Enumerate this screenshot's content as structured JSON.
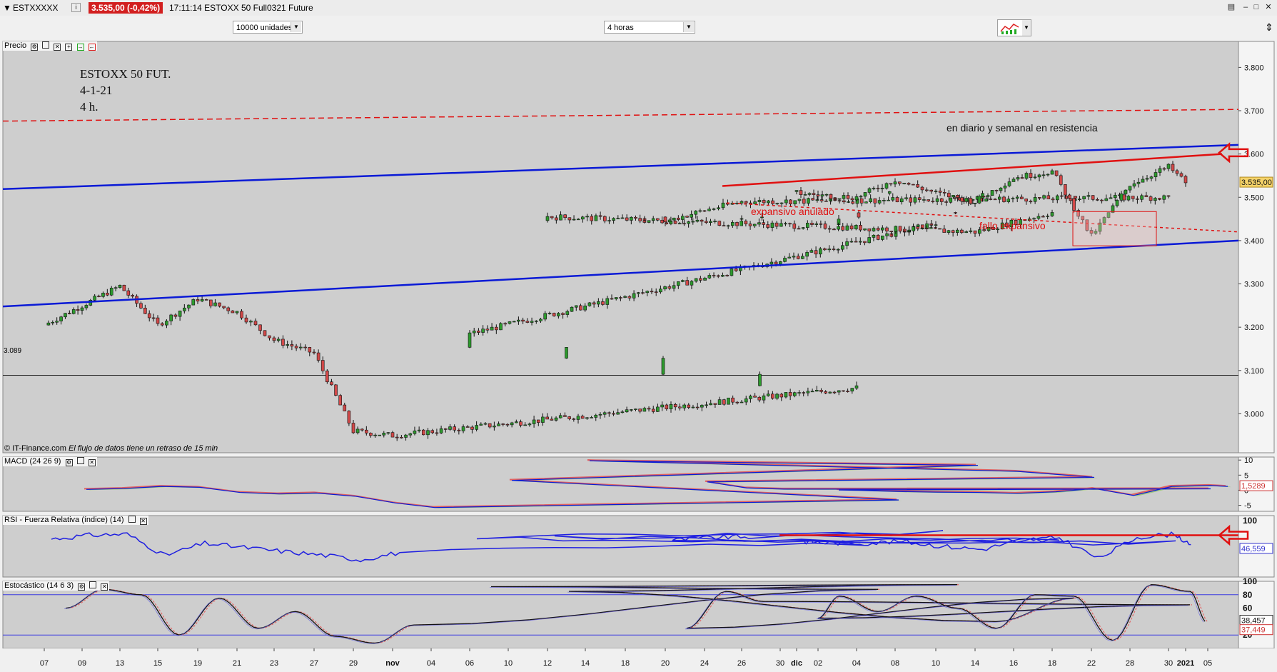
{
  "window": {
    "symbol": "ESTXXXXX",
    "quote": "3.535,00 (-0,42%)",
    "time_title": "17:11:14 ESTOXX 50 Full0321 Future"
  },
  "toolbar": {
    "units_select": "10000 unidades",
    "timeframe_select": "4 horas"
  },
  "panels": {
    "price_title": "Precio",
    "macd_title": "MACD (24 26 9)",
    "rsi_title": "RSI - Fuerza Relativa (índice) (14)",
    "stoch_title": "Estocástico (14 6 3)"
  },
  "copyright": {
    "source": "© IT-Finance.com",
    "note": "El flujo de datos tiene un retraso de 15 min"
  },
  "annotations": {
    "title_line1": "ESTOXX 50 FUT.",
    "title_line2": "4-1-21",
    "title_line3": "4 h.",
    "resistance": "en diario y semanal en resistencia",
    "expansive_cancelled": "expansivo anulado",
    "expansive_failure": "fallo expansivo",
    "hline_label": "3.089"
  },
  "colors": {
    "background": "#cecece",
    "channel": "#0a1ad6",
    "annotation_red": "#e01010",
    "candle_up": "#2d9a2d",
    "candle_down": "#d24848"
  },
  "chart_data": [
    {
      "type": "candlestick",
      "panel": "Precio",
      "timeframe": "4 horas",
      "x_ticks": [
        "07",
        "09",
        "13",
        "15",
        "19",
        "21",
        "23",
        "27",
        "29",
        "nov",
        "04",
        "06",
        "10",
        "12",
        "14",
        "18",
        "20",
        "24",
        "26",
        "30",
        "dic",
        "02",
        "04",
        "08",
        "10",
        "14",
        "16",
        "18",
        "22",
        "28",
        "30",
        "2021",
        "05"
      ],
      "y_ticks": [
        "3.000",
        "3.100",
        "3.200",
        "3.300",
        "3.400",
        "3.500",
        "3.600",
        "3.700",
        "3.800"
      ],
      "ylim": [
        2910,
        3860
      ],
      "last_price": "3.535,00",
      "horizontal_line": 3089,
      "price_path": {
        "x": [
          "07",
          "09",
          "13",
          "15",
          "19",
          "21",
          "23",
          "27",
          "29",
          "nov",
          "04",
          "06",
          "10",
          "12",
          "14",
          "18",
          "20",
          "24",
          "26",
          "30",
          "dic",
          "02",
          "04",
          "08",
          "10",
          "14",
          "16",
          "18",
          "22",
          "28",
          "30",
          "2021"
        ],
        "close": [
          3205,
          3250,
          3295,
          3205,
          3265,
          3235,
          3170,
          3140,
          2960,
          2950,
          3060,
          3185,
          3440,
          3455,
          3420,
          3465,
          3445,
          3470,
          3490,
          3500,
          3510,
          3505,
          3500,
          3540,
          3510,
          3490,
          3545,
          3560,
          3410,
          3530,
          3570,
          3535
        ]
      }
    },
    {
      "type": "line",
      "panel": "MACD (24 26 9)",
      "y_ticks": [
        "10",
        "5",
        "0",
        "-5"
      ],
      "ylim": [
        -7,
        11
      ],
      "last_value": "1,5289",
      "x": [
        "07",
        "09",
        "13",
        "15",
        "19",
        "21",
        "23",
        "27",
        "29",
        "nov",
        "04",
        "06",
        "10",
        "12",
        "14",
        "18",
        "20",
        "24",
        "26",
        "30",
        "dic",
        "02",
        "04",
        "08",
        "10",
        "14",
        "16",
        "18",
        "22",
        "28",
        "30",
        "2021"
      ],
      "series": [
        {
          "values": [
            0.5,
            0.8,
            1.5,
            1.2,
            -0.5,
            -1.0,
            -0.7,
            -1.8,
            -4.0,
            -5.5,
            -3.0,
            3.5,
            8.5,
            10.0,
            6.5,
            4.5,
            3.0,
            1.0,
            0.6,
            0.7,
            0.3,
            0.2,
            -0.2,
            -0.4,
            -0.5,
            -0.8,
            -0.3,
            0.8,
            -1.5,
            1.5,
            1.8,
            1.5
          ]
        }
      ]
    },
    {
      "type": "line",
      "panel": "RSI - Fuerza Relativa (índice) (14)",
      "y_ticks": [
        "100"
      ],
      "ylim": [
        0,
        100
      ],
      "last_value": "46,559",
      "x": [
        "07",
        "09",
        "13",
        "15",
        "19",
        "21",
        "23",
        "27",
        "29",
        "nov",
        "04",
        "06",
        "10",
        "12",
        "14",
        "18",
        "20",
        "24",
        "26",
        "30",
        "dic",
        "02",
        "04",
        "08",
        "10",
        "14",
        "16",
        "18",
        "22",
        "28",
        "30",
        "2021"
      ],
      "series": [
        {
          "values": [
            62,
            68,
            70,
            35,
            55,
            48,
            42,
            36,
            28,
            40,
            55,
            65,
            72,
            65,
            58,
            62,
            60,
            64,
            66,
            55,
            58,
            56,
            55,
            58,
            50,
            45,
            60,
            64,
            30,
            65,
            70,
            46.559
          ]
        }
      ]
    },
    {
      "type": "line",
      "panel": "Estocástico (14 6 3)",
      "y_ticks": [
        "100",
        "80",
        "60",
        "40",
        "20"
      ],
      "ylim": [
        0,
        100
      ],
      "reference_lines": [
        80,
        20
      ],
      "last_values": [
        "38,457",
        "37,449"
      ],
      "x": [
        "07",
        "09",
        "13",
        "15",
        "19",
        "21",
        "23",
        "27",
        "29",
        "nov",
        "04",
        "06",
        "10",
        "12",
        "14",
        "18",
        "20",
        "24",
        "26",
        "30",
        "dic",
        "02",
        "04",
        "08",
        "10",
        "14",
        "16",
        "18",
        "22",
        "28",
        "30",
        "2021"
      ],
      "series": [
        {
          "values": [
            60,
            88,
            80,
            20,
            75,
            30,
            55,
            18,
            8,
            35,
            88,
            92,
            95,
            85,
            40,
            75,
            30,
            85,
            70,
            65,
            45,
            78,
            55,
            78,
            60,
            30,
            80,
            78,
            12,
            95,
            85,
            38.457
          ]
        }
      ]
    }
  ]
}
